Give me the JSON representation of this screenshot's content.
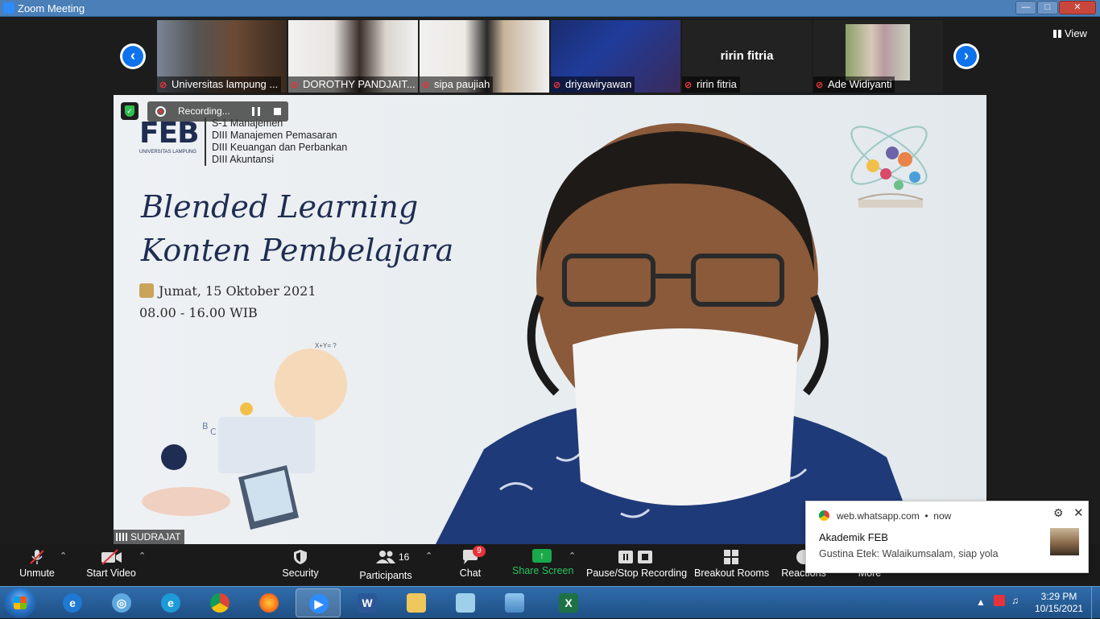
{
  "window": {
    "title": "Zoom Meeting"
  },
  "strip": {
    "view_label": "View",
    "participants": [
      {
        "name": "Universitas lampung ...",
        "muted": true
      },
      {
        "name": "DOROTHY PANDJAIT...",
        "muted": true
      },
      {
        "name": "sipa paujiah",
        "muted": true
      },
      {
        "name": "driyawiryawan",
        "muted": true
      },
      {
        "name": "ririn fitria",
        "muted": true,
        "big_name": "ririn fitria"
      },
      {
        "name": "Ade Widiyanti",
        "muted": true
      }
    ]
  },
  "recording": {
    "label": "Recording..."
  },
  "slide": {
    "logo": "FEB",
    "logo_sub": "UNIVERSITAS LAMPUNG",
    "programs": [
      "S-1 Manajemen",
      "DIII Manajemen Pemasaran",
      "DIII Keuangan dan Perbankan",
      "DIII Akuntansi"
    ],
    "title_line1": "Blended Learning",
    "title_line2": "Konten Pembelajara",
    "date": "Jumat, 15 Oktober 2021",
    "time": "08.00 - 16.00 WIB",
    "formula": "X+Y= ?"
  },
  "speaker": {
    "name": "SUDRAJAT"
  },
  "toolbar": {
    "unmute": "Unmute",
    "start_video": "Start Video",
    "security": "Security",
    "participants": "Participants",
    "participants_count": "16",
    "chat": "Chat",
    "chat_badge": "9",
    "share_screen": "Share Screen",
    "pause_stop_recording": "Pause/Stop Recording",
    "breakout_rooms": "Breakout Rooms",
    "reactions": "Reactions",
    "more": "More"
  },
  "notification": {
    "source": "web.whatsapp.com",
    "time": "now",
    "title": "Akademik FEB",
    "message": "Gustina Etek: Walaikumsalam, siap yola"
  },
  "taskbar": {
    "time": "3:29 PM",
    "date": "10/15/2021"
  }
}
